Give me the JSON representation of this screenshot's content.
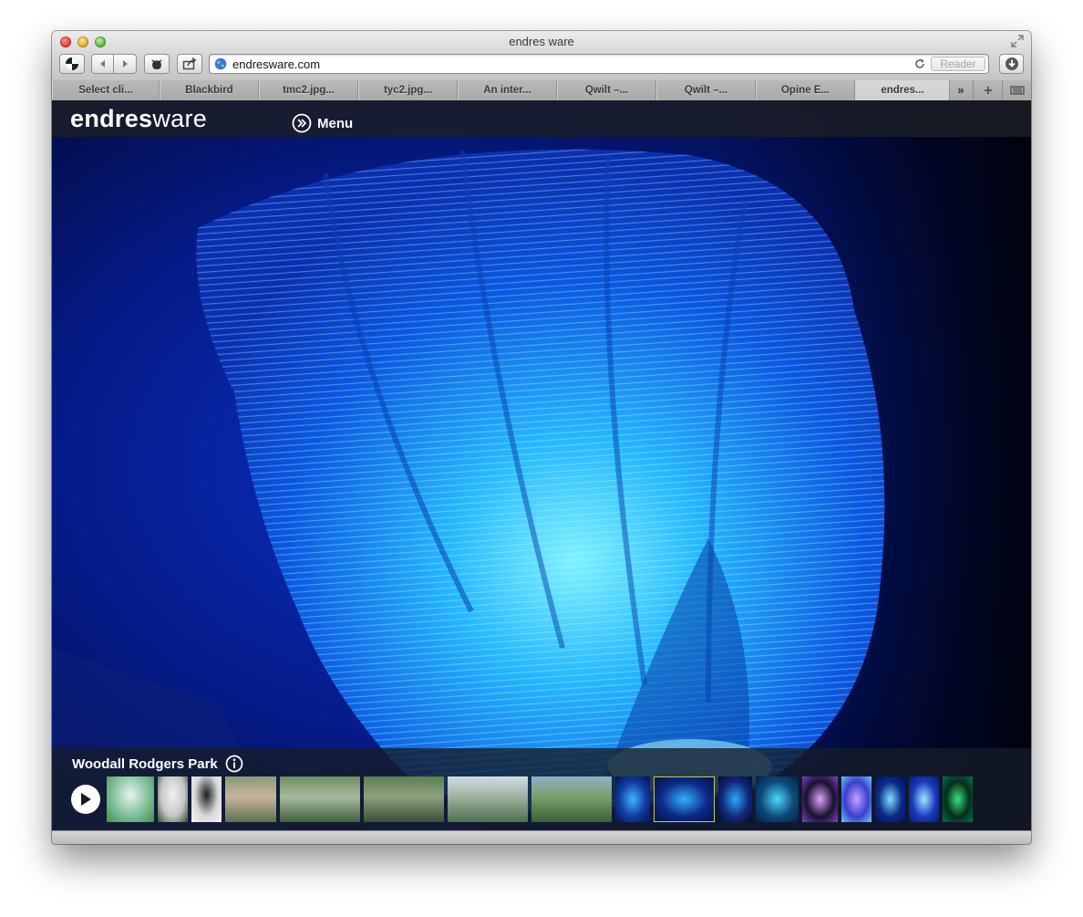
{
  "window": {
    "title": "endres ware"
  },
  "toolbar": {
    "url": "endresware.com",
    "reader_label": "Reader"
  },
  "tabs": [
    {
      "label": "Select cli...",
      "active": false
    },
    {
      "label": "Blackbird",
      "active": false
    },
    {
      "label": "tmc2.jpg...",
      "active": false
    },
    {
      "label": "tyc2.jpg...",
      "active": false
    },
    {
      "label": "An inter...",
      "active": false
    },
    {
      "label": "Qwilt –...",
      "active": false
    },
    {
      "label": "Qwilt –...",
      "active": false
    },
    {
      "label": "Opine E...",
      "active": false
    },
    {
      "label": "endres...",
      "active": true
    }
  ],
  "tab_overflow_label": "»",
  "site": {
    "logo_bold": "endres",
    "logo_light": "ware",
    "menu_label": "Menu"
  },
  "gallery": {
    "caption": "Woodall Rodgers Park",
    "selected_index": 9,
    "thumbnails": [
      {
        "kind": "render-white",
        "colors": [
          "#e9f3ef",
          "#7fbf9a",
          "#3f8f4e"
        ]
      },
      {
        "kind": "render-white",
        "colors": [
          "#f0f0f0",
          "#c7c7c7",
          "#2f4d2a"
        ]
      },
      {
        "kind": "render-white",
        "colors": [
          "#1a1f20",
          "#d8d8d8",
          "#f4f4f4"
        ]
      },
      {
        "kind": "aerial",
        "colors": [
          "#8a9a7a",
          "#c7b49a",
          "#5d6f4f"
        ]
      },
      {
        "kind": "park",
        "colors": [
          "#6f8f5f",
          "#a9b9a0",
          "#3f5f3a"
        ]
      },
      {
        "kind": "park",
        "colors": [
          "#5f7f4f",
          "#8fa07f",
          "#3a4f35"
        ]
      },
      {
        "kind": "city",
        "colors": [
          "#d0dde6",
          "#9fb0a0",
          "#4f6f4a"
        ]
      },
      {
        "kind": "park",
        "colors": [
          "#8fb0c7",
          "#79a069",
          "#3a5f35"
        ]
      },
      {
        "kind": "blue",
        "colors": [
          "#0f3aa0",
          "#3fb7ff",
          "#06124f"
        ]
      },
      {
        "kind": "blue",
        "colors": [
          "#0c2a88",
          "#35b0ff",
          "#041040"
        ]
      },
      {
        "kind": "blue",
        "colors": [
          "#102a7a",
          "#2fa7ff",
          "#030a30"
        ]
      },
      {
        "kind": "blue",
        "colors": [
          "#0c4a7a",
          "#4fd7ff",
          "#03213f"
        ]
      },
      {
        "kind": "purple",
        "colors": [
          "#1a1030",
          "#e0a0ff",
          "#7f3fbf"
        ]
      },
      {
        "kind": "purple",
        "colors": [
          "#3a3fd0",
          "#c7a0ff",
          "#6fc7ff"
        ]
      },
      {
        "kind": "blue",
        "colors": [
          "#0a2a8a",
          "#7fe0ff",
          "#04105a"
        ]
      },
      {
        "kind": "blue",
        "colors": [
          "#1a3abf",
          "#a0e7ff",
          "#081a6a"
        ]
      },
      {
        "kind": "green",
        "colors": [
          "#022f1a",
          "#3fe07f",
          "#0a6f4f"
        ]
      }
    ]
  }
}
